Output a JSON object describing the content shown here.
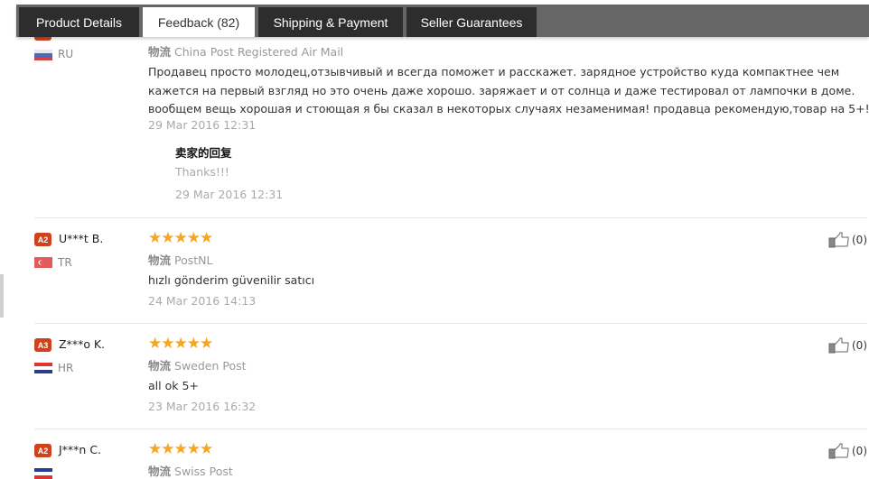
{
  "tabs": [
    {
      "label": "Product Details",
      "active": false
    },
    {
      "label": "Feedback (82)",
      "active": true
    },
    {
      "label": "Shipping & Payment",
      "active": false
    },
    {
      "label": "Seller Guarantees",
      "active": false
    }
  ],
  "logistics_label": "物流",
  "reviews": [
    {
      "country": "RU",
      "logistics": "China Post Registered Air Mail",
      "text": "Продавец просто молодец,отзывчивый и всегда поможет и расскажет. зарядное устройство куда компактнее чем кажется на первый взгляд но это очень даже хорошо. заряжает и от солнца и даже тестировал от лампочки в доме. вообщем вещь хорошая и стоющая я бы сказал в некоторых случаях незаменимая! продавца рекомендую,товар на 5+!",
      "date": "29 Mar 2016 12:31",
      "reply": {
        "title": "卖家的回复",
        "text": "Thanks!!!",
        "date": "29 Mar 2016 12:31"
      }
    },
    {
      "badge": "A2",
      "user": "U***t B.",
      "country": "TR",
      "rating": 5,
      "stars": "★★★★★",
      "logistics": "PostNL",
      "text": "hızlı gönderim güvenilir satıcı",
      "date": "24 Mar 2016 14:13",
      "likes": "(0)"
    },
    {
      "badge": "A3",
      "user": "Z***o K.",
      "country": "HR",
      "rating": 5,
      "stars": "★★★★★",
      "logistics": "Sweden Post",
      "text": "all ok 5+",
      "date": "23 Mar 2016 16:32",
      "likes": "(0)"
    },
    {
      "badge": "A2",
      "user": "J***n C.",
      "country": "",
      "rating": 5,
      "stars": "★★★★★",
      "logistics": "Swiss Post",
      "likes": "(0)"
    }
  ],
  "colors": {
    "accent_star": "#f5a623",
    "badge": "#d0421b",
    "tab_bg": "#2d2d2d",
    "tabbar_bg": "#666666"
  }
}
